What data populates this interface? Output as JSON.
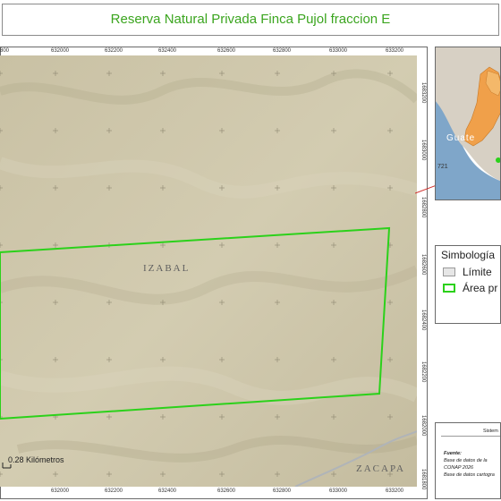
{
  "title": "Reserva Natural Privada Finca Pujol fraccion E",
  "map": {
    "x_ticks": [
      "632000",
      "632200",
      "632400",
      "632600",
      "632800",
      "633000",
      "633200"
    ],
    "x_tick_first_partial": "800",
    "x_ticks_bottom": [
      "632000",
      "632200",
      "632400",
      "632600",
      "632800",
      "633000",
      "633200"
    ],
    "y_ticks": [
      "1682800",
      "1682600",
      "1682400",
      "1682200",
      "1682000",
      "1681800",
      "1683200",
      "1683000"
    ],
    "labels": {
      "izabal": "IZABAL",
      "zacapa": "ZACAPA"
    },
    "scale_label": "0.28 Kilómetros",
    "polygon_color": "#2bd11a"
  },
  "inset": {
    "label_guatemala": "Guate",
    "label_721": "721",
    "highlight_color": "#f0a04a"
  },
  "legend": {
    "title": "Simbología",
    "items": [
      {
        "label": "Límite",
        "kind": "limit"
      },
      {
        "label": "Área pr",
        "kind": "area"
      }
    ]
  },
  "info": {
    "system": "Sistem",
    "lines": [
      "Fuente:",
      "Base de datos de la",
      "CONAP 2026",
      "Base de datos cartogra"
    ]
  }
}
